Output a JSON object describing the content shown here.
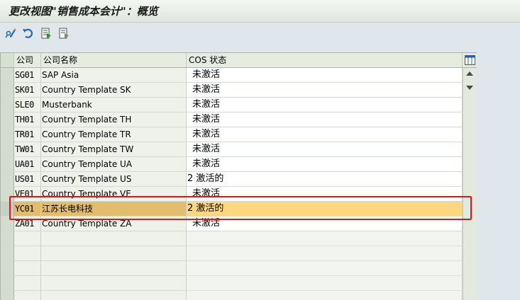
{
  "window": {
    "title": "更改视图\"销售成本会计\"：概览"
  },
  "toolbar": {
    "buttons": [
      {
        "name": "display-change-icon"
      },
      {
        "name": "undo-icon"
      },
      {
        "name": "select-all-icon"
      },
      {
        "name": "deselect-all-icon"
      }
    ]
  },
  "table": {
    "headers": {
      "code": "公司",
      "name": "公司名称",
      "status": "COS 状态"
    },
    "rows": [
      {
        "code": "SG01",
        "name": "SAP Asia",
        "status": "未激活"
      },
      {
        "code": "SK01",
        "name": "Country Template SK",
        "status": "未激活"
      },
      {
        "code": "SLE0",
        "name": "Musterbank",
        "status": "未激活"
      },
      {
        "code": "TH01",
        "name": "Country Template TH",
        "status": "未激活"
      },
      {
        "code": "TR01",
        "name": "Country Template TR",
        "status": "未激活"
      },
      {
        "code": "TW01",
        "name": "Country Template TW",
        "status": "未激活"
      },
      {
        "code": "UA01",
        "name": "Country Template UA",
        "status": "未激活"
      },
      {
        "code": "US01",
        "name": "Country Template US",
        "status": "2 激活的"
      },
      {
        "code": "VE01",
        "name": "Country Template VE",
        "status": "未激活"
      },
      {
        "code": "YC01",
        "name": "江苏长电科技",
        "status": "2 激活的"
      },
      {
        "code": "ZA01",
        "name": "Country Template ZA",
        "status": "未激活"
      }
    ],
    "highlighted_row": "YC01",
    "highlight_color": "#fcd77f",
    "annotation_color": "#e3141b"
  }
}
